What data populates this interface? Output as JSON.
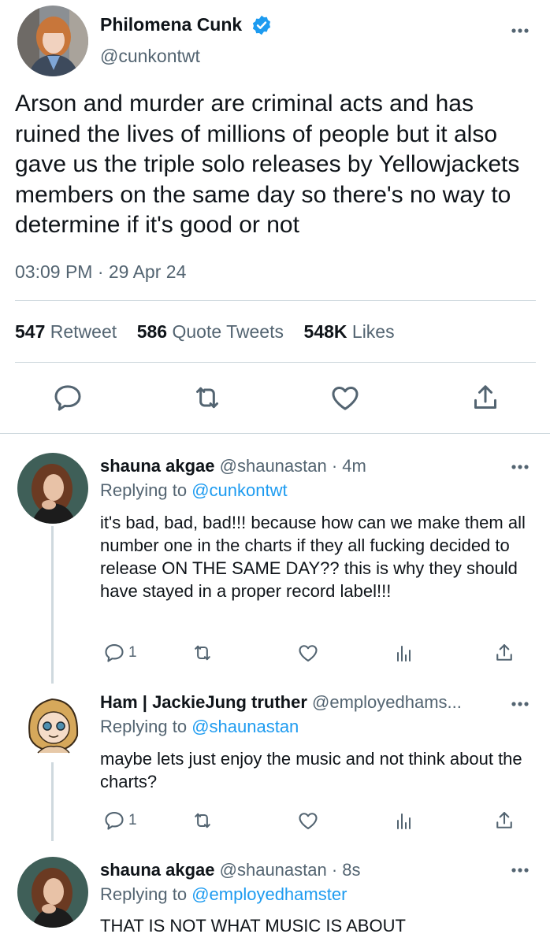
{
  "tweet": {
    "name": "Philomena Cunk",
    "handle": "@cunkontwt",
    "text": "Arson and murder are criminal acts and has ruined the lives of millions of people but it also gave us the triple solo releases by Yellowjackets members on the same day so there's no way to determine if it's good or not",
    "timestamp": "03:09 PM · 29 Apr 24",
    "retweets": "547",
    "retweets_label": "Retweet",
    "quotes": "586",
    "quotes_label": "Quote Tweets",
    "likes": "548K",
    "likes_label": "Likes"
  },
  "replies": [
    {
      "name": "shauna akgae",
      "handle_time": "@shaunastan · 4m",
      "replying_prefix": "Replying to",
      "replying_to": "@cunkontwt",
      "text": "it's bad, bad, bad!!! because how can we make them all number one in the charts if they all fucking decided to release ON THE SAME DAY?? this is why they should have stayed in a proper record label!!!",
      "reply_count": "1"
    },
    {
      "name": "Ham | JackieJung truther",
      "handle_time": "@employedhams...",
      "replying_prefix": "Replying to",
      "replying_to": "@shaunastan",
      "text": "maybe lets just enjoy the music and not think about the charts?",
      "reply_count": "1"
    },
    {
      "name": "shauna akgae",
      "handle_time": "@shaunastan · 8s",
      "replying_prefix": "Replying to",
      "replying_to": "@employedhamster",
      "text": "THAT IS NOT WHAT MUSIC IS ABOUT"
    }
  ],
  "colors": {
    "accent": "#1d9bf0",
    "muted": "#536471",
    "text": "#0f1419",
    "divider": "#cfd9de"
  }
}
